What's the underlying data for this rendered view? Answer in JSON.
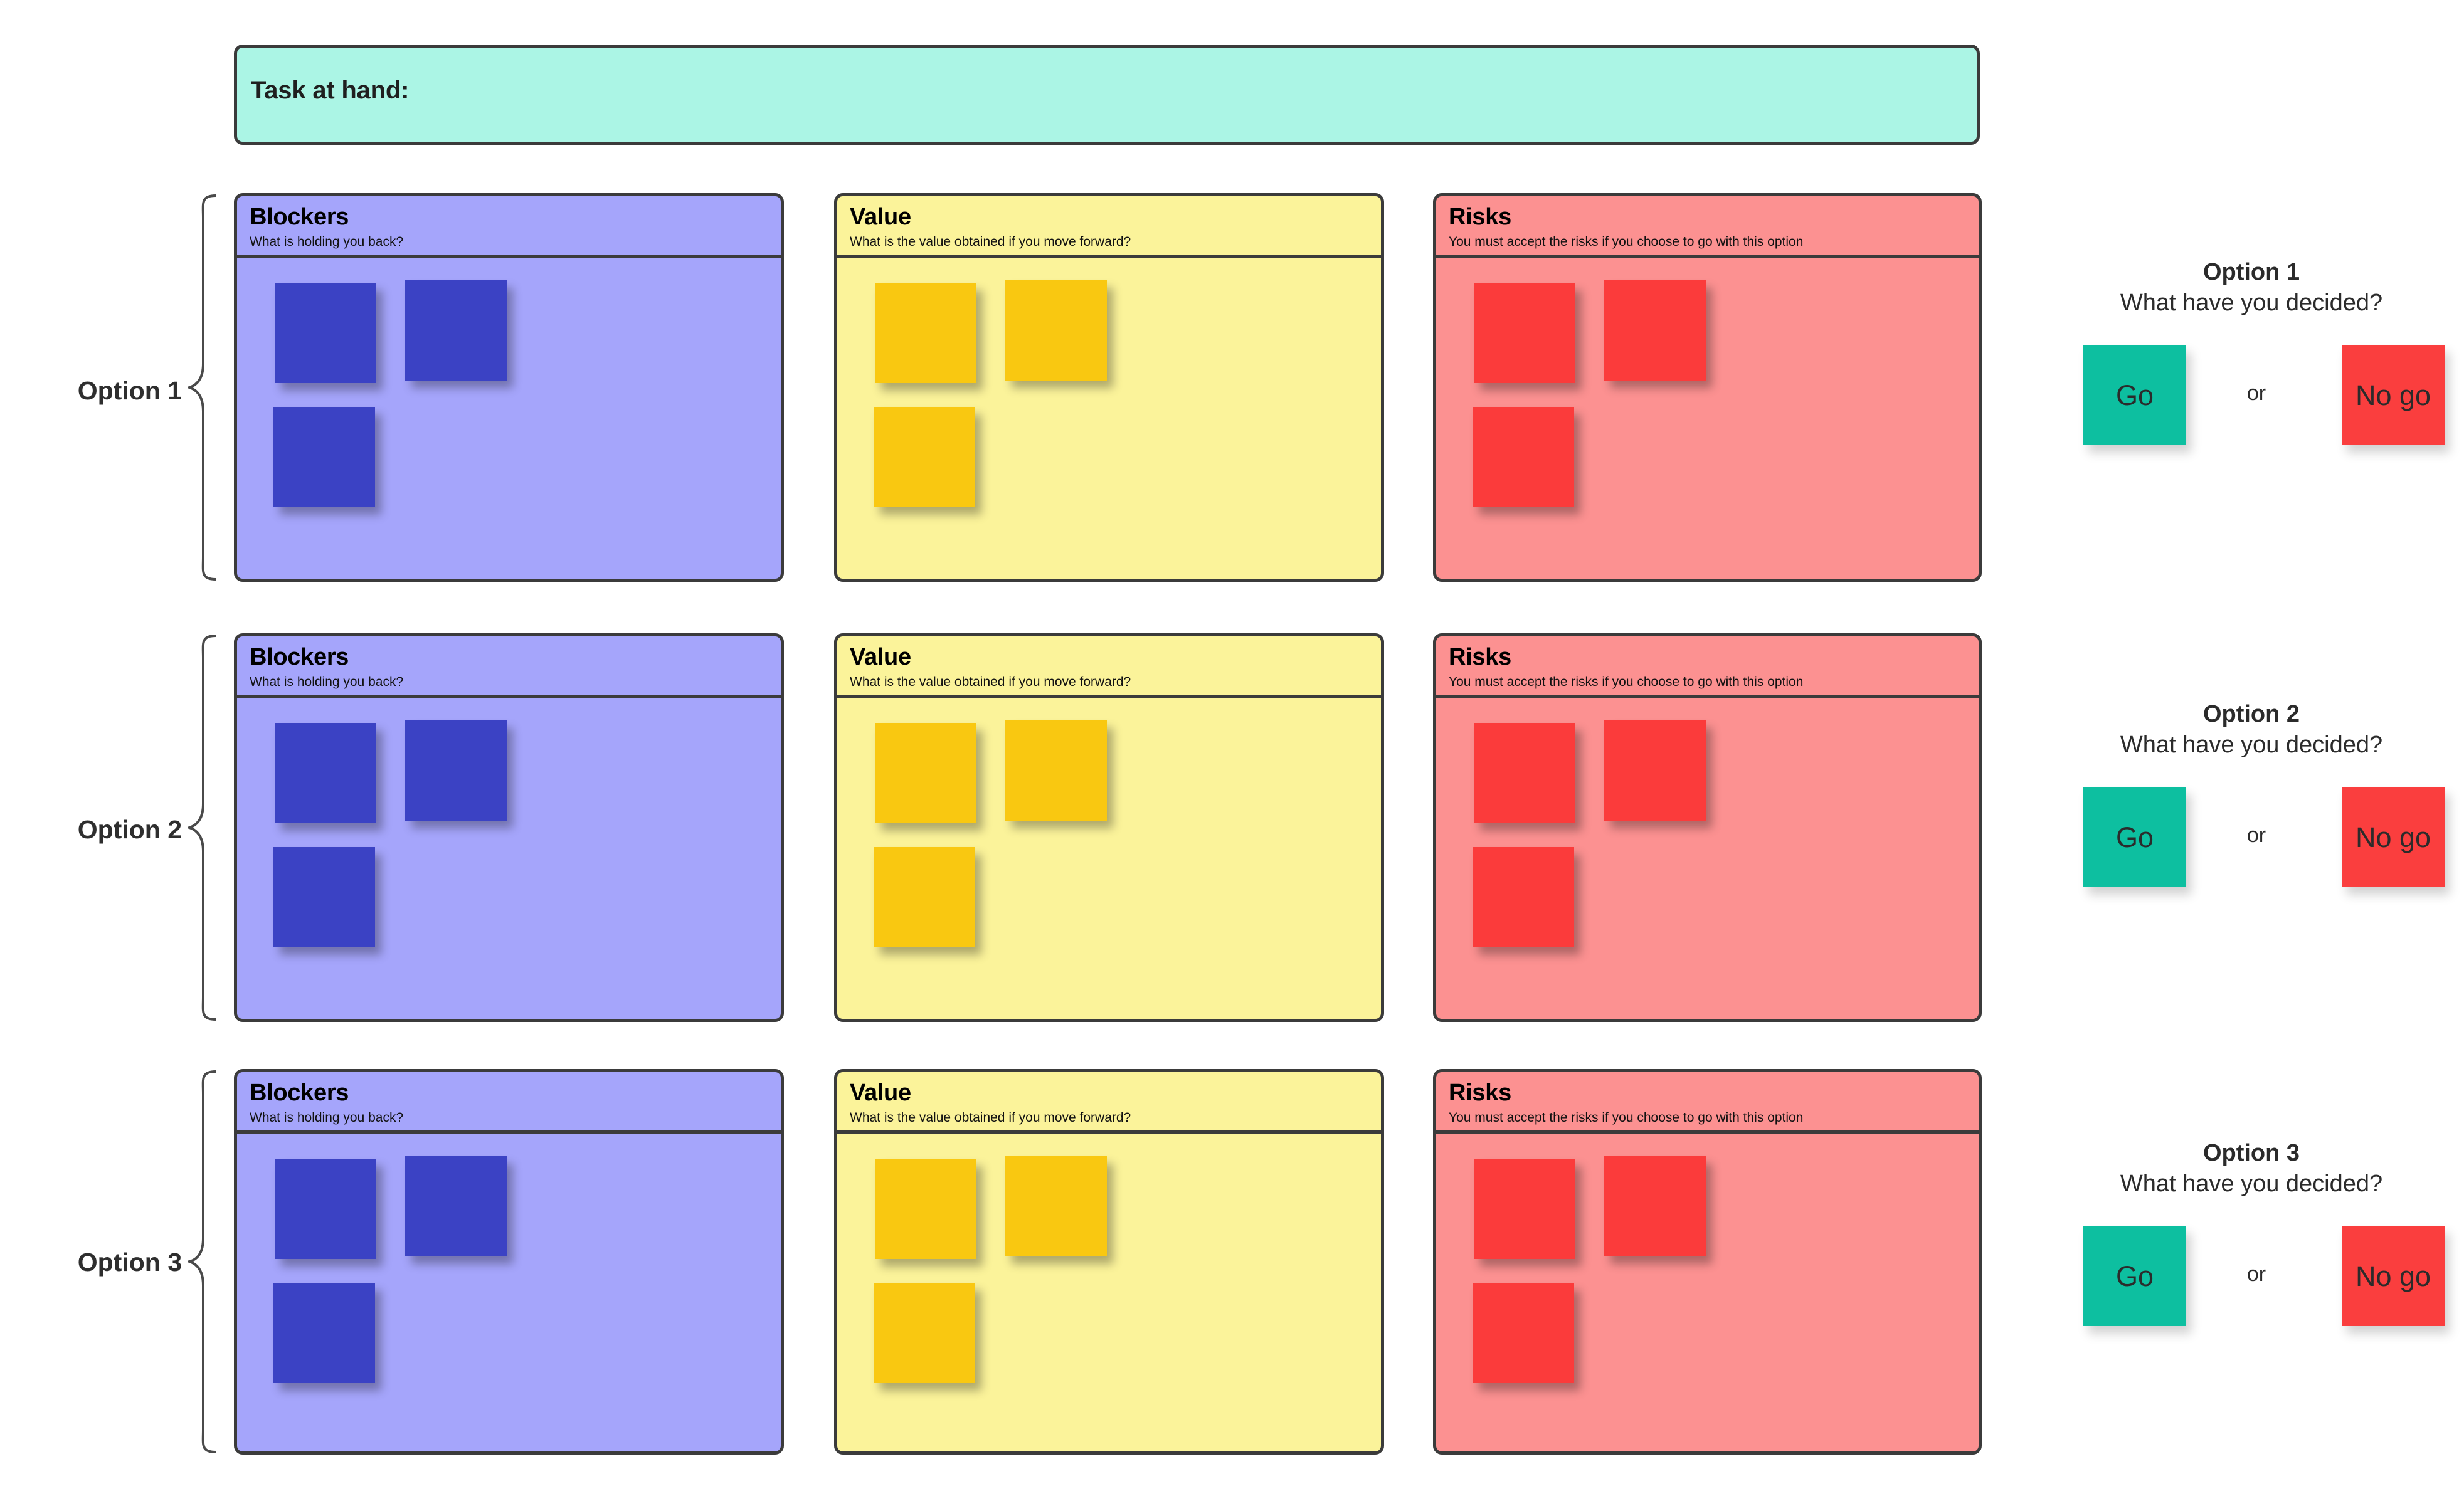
{
  "header": {
    "task_label": "Task at hand:",
    "value": "",
    "bg_color": "#abf5e5",
    "border_color": "#3b3b3b"
  },
  "columns": [
    {
      "key": "blockers",
      "title": "Blockers",
      "subtitle": "What is holding you back?",
      "bg_color": "#a5a5fb",
      "note_color": "#3b42c4"
    },
    {
      "key": "value",
      "title": "Value",
      "subtitle": "What is the value obtained if you move forward?",
      "bg_color": "#fbf39a",
      "note_color": "#f9c811"
    },
    {
      "key": "risks",
      "title": "Risks",
      "subtitle": "You must accept the risks if you choose to go with this option",
      "bg_color": "#fc9191",
      "note_color": "#fb3b3b"
    }
  ],
  "rows": [
    {
      "label": "Option 1",
      "notes": {
        "blockers": [
          "",
          "",
          ""
        ],
        "value": [
          "",
          "",
          ""
        ],
        "risks": [
          "",
          "",
          ""
        ]
      }
    },
    {
      "label": "Option 2",
      "notes": {
        "blockers": [
          "",
          "",
          ""
        ],
        "value": [
          "",
          "",
          ""
        ],
        "risks": [
          "",
          "",
          ""
        ]
      }
    },
    {
      "label": "Option 3",
      "notes": {
        "blockers": [
          "",
          "",
          ""
        ],
        "value": [
          "",
          "",
          ""
        ],
        "risks": [
          "",
          "",
          ""
        ]
      }
    }
  ],
  "decisions": [
    {
      "title": "Option 1",
      "question": "What have you decided?",
      "go_label": "Go",
      "or_label": "or",
      "nogo_label": "No go",
      "go_color": "#0dbfa0",
      "nogo_color": "#fa3e3e"
    },
    {
      "title": "Option 2",
      "question": "What have you decided?",
      "go_label": "Go",
      "or_label": "or",
      "nogo_label": "No go",
      "go_color": "#0dbfa0",
      "nogo_color": "#fa3e3e"
    },
    {
      "title": "Option 3",
      "question": "What have you decided?",
      "go_label": "Go",
      "or_label": "or",
      "nogo_label": "No go",
      "go_color": "#0dbfa0",
      "nogo_color": "#fa3e3e"
    }
  ]
}
